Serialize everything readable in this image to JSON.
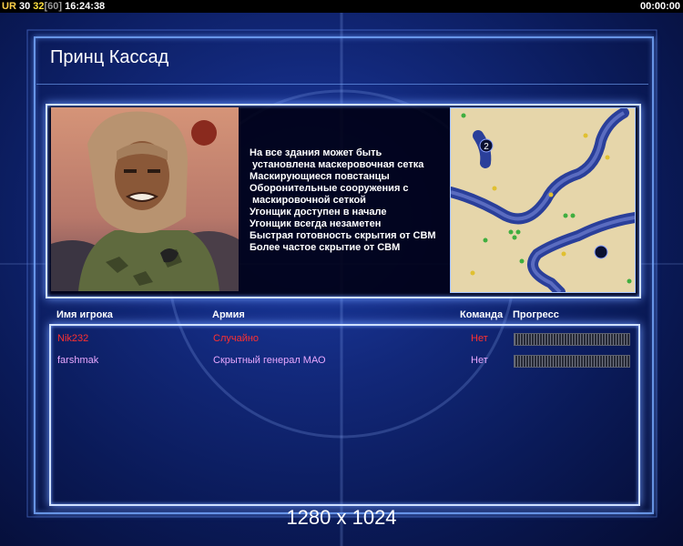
{
  "topbar": {
    "ur": "UR",
    "val1": "30",
    "val2": "32",
    "val3": "[60]",
    "clock": "16:24:38",
    "timer": "00:00:00"
  },
  "general": {
    "title": "Принц Кассад",
    "features": [
      "На все здания может быть",
      " установлена маскеровочная сетка",
      "Маскирующиеся повстанцы",
      "Оборонительные сооружения с",
      " маскировочной сеткой",
      "Угонщик доступен в начале",
      "Угонщик всегда незаметен",
      "Быстрая готовность скрытия от СВМ",
      "Более частое скрытие от СВМ"
    ],
    "map_marker": "2"
  },
  "players": {
    "headers": {
      "name": "Имя игрока",
      "army": "Армия",
      "team": "Команда",
      "progress": "Прогресс"
    },
    "rows": [
      {
        "name": "Nik232",
        "army": "Случайно",
        "team": "Нет",
        "progress": 1.0,
        "color": "#ff3030"
      },
      {
        "name": "farshmak",
        "army": "Скрытный генерал МАО",
        "team": "Нет",
        "progress": 1.0,
        "color": "#e8a8ff"
      }
    ]
  },
  "resolution": "1280 x 1024"
}
